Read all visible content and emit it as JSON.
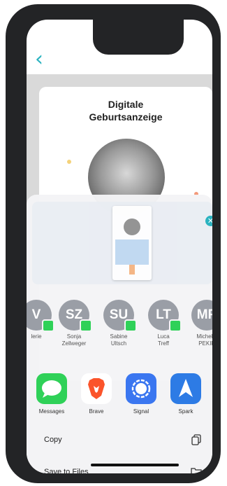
{
  "app": {
    "back_icon": "chevron-left-icon",
    "accent_color": "#2bb3c0"
  },
  "card": {
    "title_line1": "Digitale",
    "title_line2": "Geburtsanzeige"
  },
  "share_sheet": {
    "close_icon": "close-icon",
    "contacts": [
      {
        "initials": "V",
        "name_line1": "lerie",
        "name_line2": ""
      },
      {
        "initials": "SZ",
        "name_line1": "Sonja",
        "name_line2": "Zellweger"
      },
      {
        "initials": "SU",
        "name_line1": "Sabine",
        "name_line2": "Ultsch"
      },
      {
        "initials": "LT",
        "name_line1": "Luca",
        "name_line2": "Treff"
      },
      {
        "initials": "MP",
        "name_line1": "Michelle",
        "name_line2": "PEKIP"
      }
    ],
    "apps": [
      {
        "label": "Messages",
        "icon": "messages-icon",
        "color": "#2fd158"
      },
      {
        "label": "Brave",
        "icon": "brave-icon",
        "color": "#fb542b"
      },
      {
        "label": "Signal",
        "icon": "signal-icon",
        "color": "#3a76f0"
      },
      {
        "label": "Spark",
        "icon": "spark-icon",
        "color": "#2d7be5"
      }
    ],
    "actions": [
      {
        "label": "Copy",
        "icon": "copy-icon"
      },
      {
        "label": "Save to Files",
        "icon": "folder-icon"
      }
    ]
  }
}
